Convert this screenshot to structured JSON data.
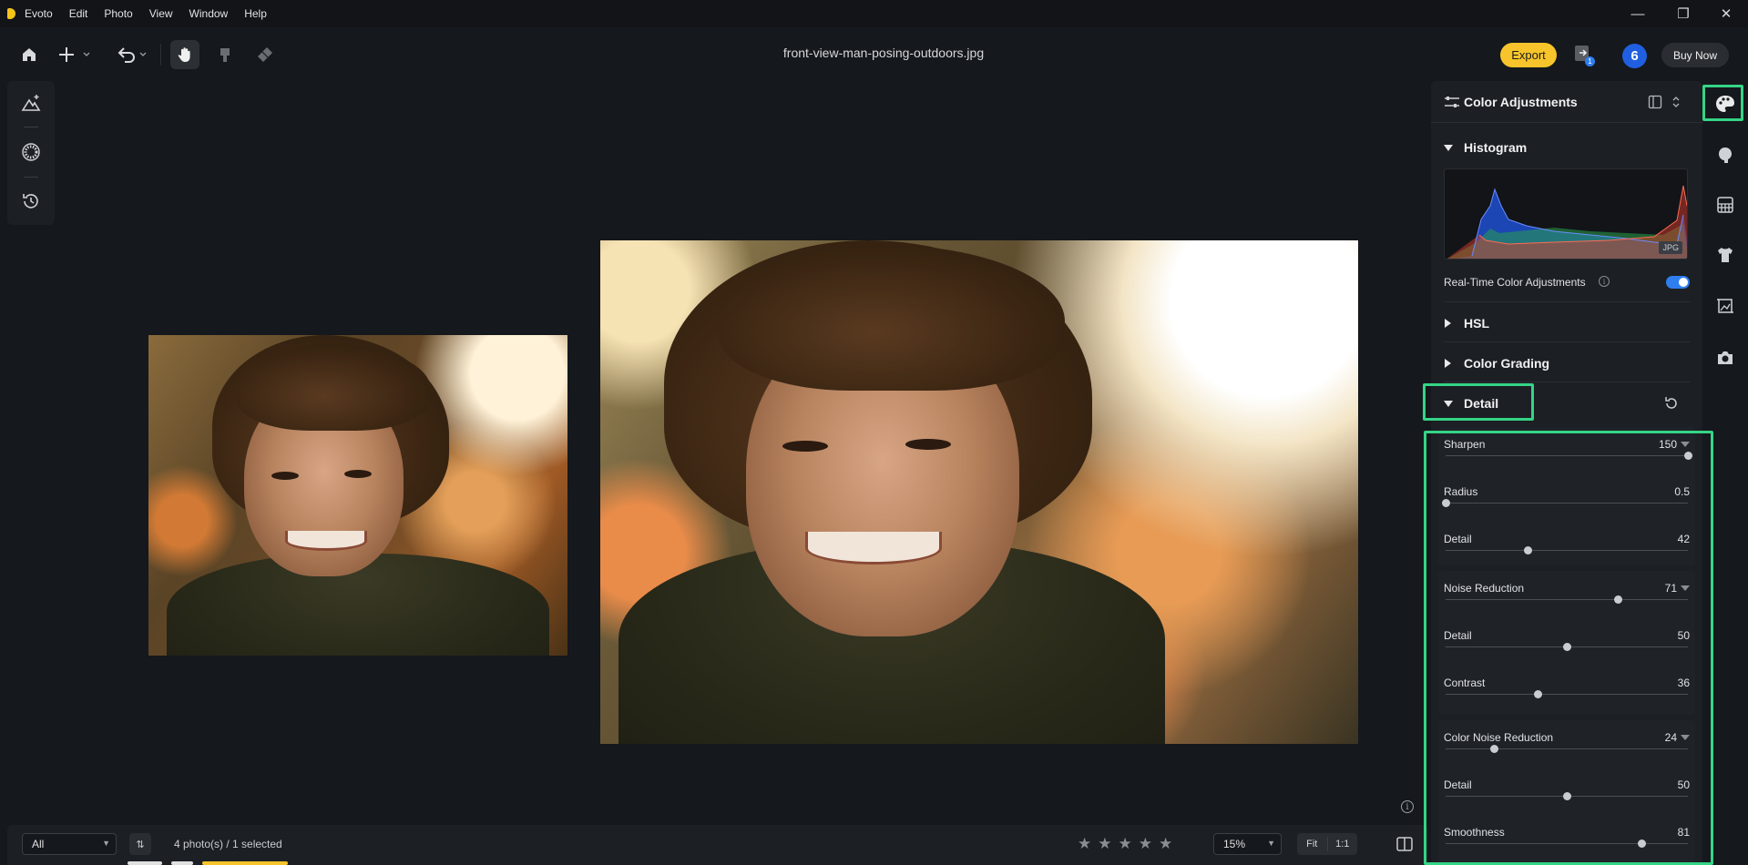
{
  "app": {
    "name": "Evoto",
    "menu": [
      "Edit",
      "Photo",
      "View",
      "Window",
      "Help"
    ]
  },
  "window_controls": {
    "minimize": "—",
    "restore": "❐",
    "close": "✕"
  },
  "toolbar": {
    "file_name": "front-view-man-posing-outdoors.jpg",
    "export_label": "Export",
    "notification_count": "1",
    "avatar_initial": "6",
    "buy_now_label": "Buy Now"
  },
  "colors": {
    "accent_yellow": "#f7c52b",
    "highlight_green": "#35d486",
    "toggle_blue": "#2f7ef0"
  },
  "panel": {
    "title": "Color Adjustments",
    "histogram": {
      "title": "Histogram",
      "format_tag": "JPG"
    },
    "realtime": {
      "label": "Real-Time Color Adjustments",
      "enabled": true,
      "info": "i"
    },
    "sections": {
      "hsl": "HSL",
      "color_grading": "Color Grading",
      "detail": "Detail"
    },
    "sharpen_group": [
      {
        "label": "Sharpen",
        "value": "150",
        "fraction": 1.0,
        "expandable": true
      },
      {
        "label": "Radius",
        "value": "0.5",
        "fraction": 0.0,
        "expandable": false
      },
      {
        "label": "Detail",
        "value": "42",
        "fraction": 0.34,
        "expandable": false
      }
    ],
    "noise_group": [
      {
        "label": "Noise Reduction",
        "value": "71",
        "fraction": 0.71,
        "expandable": true
      },
      {
        "label": "Detail",
        "value": "50",
        "fraction": 0.5,
        "expandable": false
      },
      {
        "label": "Contrast",
        "value": "36",
        "fraction": 0.38,
        "expandable": false
      }
    ],
    "color_noise_group": [
      {
        "label": "Color Noise Reduction",
        "value": "24",
        "fraction": 0.2,
        "expandable": true
      },
      {
        "label": "Detail",
        "value": "50",
        "fraction": 0.5,
        "expandable": false
      },
      {
        "label": "Smoothness",
        "value": "81",
        "fraction": 0.81,
        "expandable": false
      }
    ]
  },
  "bottom": {
    "filter_value": "All",
    "sort_label": "⇅",
    "photo_count": "4 photo(s) / 1 selected",
    "rating_max": 5,
    "zoom_value": "15%",
    "fit_label": "Fit",
    "one_to_one_label": "1:1"
  },
  "canvas": {
    "info_label": "i"
  }
}
